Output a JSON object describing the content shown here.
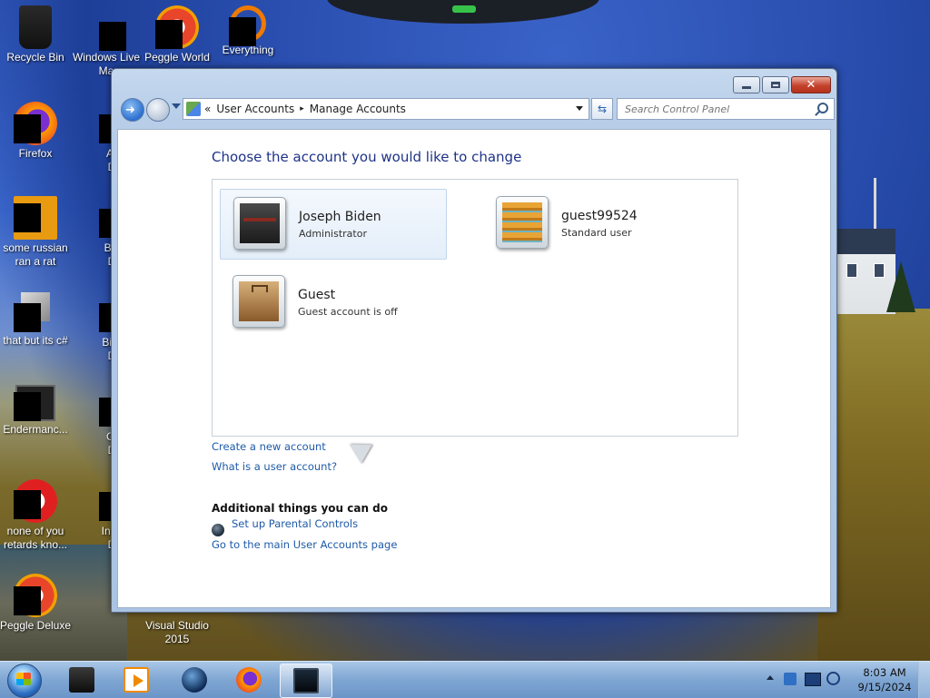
{
  "desktop": {
    "icons": [
      {
        "label": "Recycle Bin"
      },
      {
        "label": "Windows Live Ma"
      },
      {
        "label": "Peggle World"
      },
      {
        "label": "Everything"
      },
      {
        "label": "Firefox"
      },
      {
        "label": "Astro Delu"
      },
      {
        "label": "some russian ran a rat"
      },
      {
        "label": "Bejew Delu"
      },
      {
        "label": "that but its c#"
      },
      {
        "label": "Big Mo Delu"
      },
      {
        "label": "Endermanc..."
      },
      {
        "label": "Chuz Delu"
      },
      {
        "label": "none of you retards kno..."
      },
      {
        "label": "Insaniq Delu"
      },
      {
        "label": "Peggle Deluxe"
      },
      {
        "label": "Visual Studio 2015"
      }
    ]
  },
  "window": {
    "breadcrumb": {
      "prefix": "«",
      "items": [
        "User Accounts",
        "Manage Accounts"
      ],
      "separator": "▸"
    },
    "search": {
      "placeholder": "Search Control Panel"
    },
    "heading": "Choose the account you would like to change",
    "accounts": [
      {
        "name": "Joseph Biden",
        "role": "Administrator",
        "selected": true
      },
      {
        "name": "guest99524",
        "role": "Standard user",
        "selected": false
      },
      {
        "name": "Guest",
        "role": "Guest account is off",
        "selected": false
      }
    ],
    "links": {
      "create": "Create a new account",
      "what_is": "What is a user account?"
    },
    "additional": {
      "title": "Additional things you can do",
      "parental": "Set up Parental Controls",
      "main_page": "Go to the main User Accounts page"
    },
    "controls": {
      "close": "✕"
    }
  },
  "taskbar": {
    "pinned": [
      "box-app-icon",
      "media-player-icon",
      "globe-app-icon",
      "firefox-icon",
      "control-panel-icon"
    ],
    "active": "control-panel-icon",
    "clock": {
      "time": "8:03 AM",
      "date": "9/15/2024"
    }
  },
  "colors": {
    "heading": "#1e3287",
    "link": "#1e5aa8",
    "taskbar": "#7fa6d3"
  }
}
